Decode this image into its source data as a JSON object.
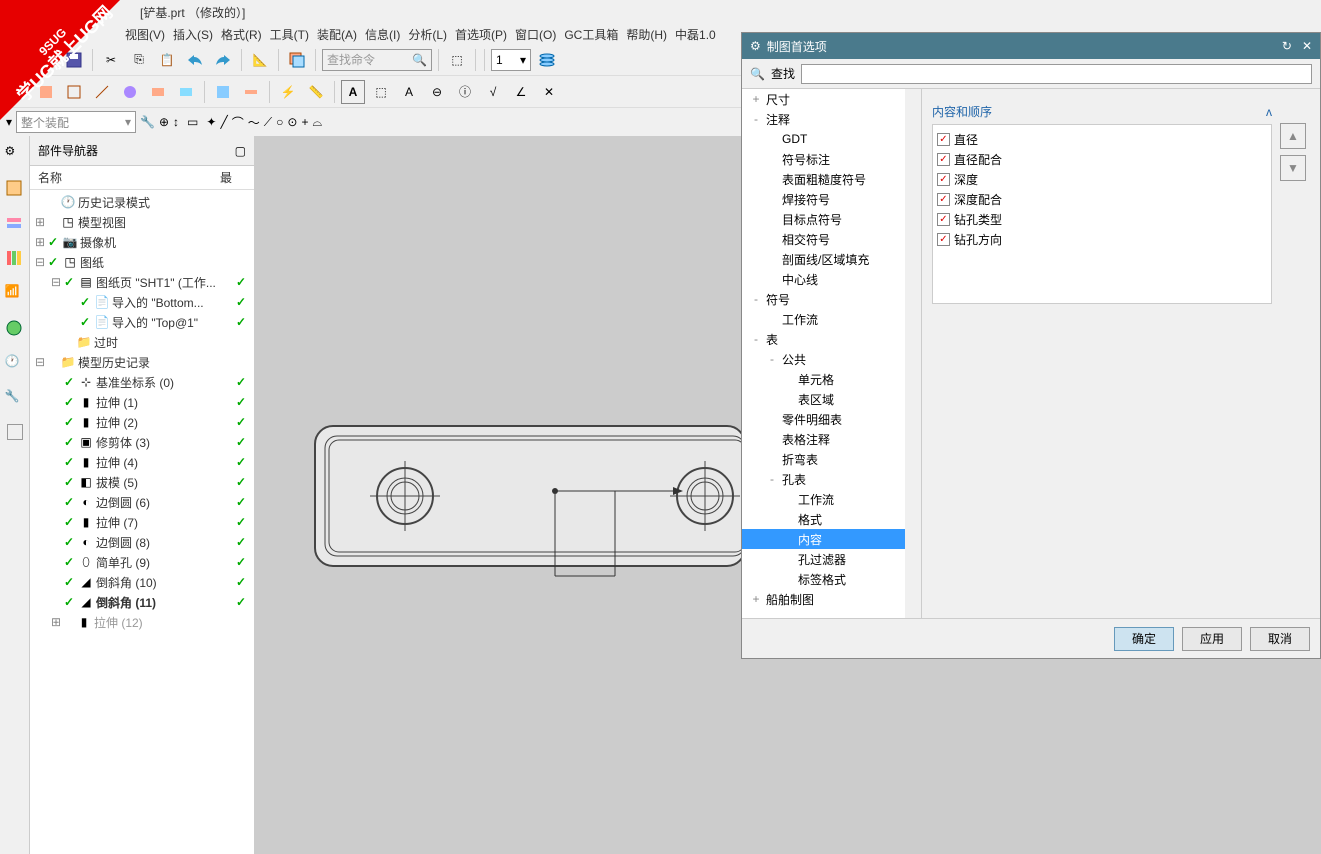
{
  "title": "[铲基.prt （修改的）]",
  "watermark": {
    "line1": "9SUG",
    "line2": "学UG就上UG网"
  },
  "menus": [
    "视图(V)",
    "插入(S)",
    "格式(R)",
    "工具(T)",
    "装配(A)",
    "信息(I)",
    "分析(L)",
    "首选项(P)",
    "窗口(O)",
    "GC工具箱",
    "帮助(H)",
    "中磊1.0"
  ],
  "toolbar": {
    "search_placeholder": "查找命令",
    "page_num": "1"
  },
  "assembly_combo": "整个装配",
  "nav": {
    "title": "部件导航器",
    "col1": "名称",
    "col2": "最",
    "items": [
      {
        "indent": 0,
        "exp": "",
        "chk": false,
        "icon": "clock",
        "label": "历史记录模式",
        "tick": false
      },
      {
        "indent": 0,
        "exp": "+",
        "chk": false,
        "icon": "cube-g",
        "label": "模型视图",
        "tick": false
      },
      {
        "indent": 0,
        "exp": "+",
        "chk": true,
        "icon": "camera",
        "label": "摄像机",
        "tick": false
      },
      {
        "indent": 0,
        "exp": "-",
        "chk": true,
        "icon": "cube-b",
        "label": "图纸",
        "tick": false
      },
      {
        "indent": 1,
        "exp": "-",
        "chk": true,
        "icon": "sheet",
        "label": "图纸页 \"SHT1\" (工作...",
        "tick": true
      },
      {
        "indent": 2,
        "exp": "",
        "chk": true,
        "icon": "page",
        "label": "导入的 \"Bottom...",
        "tick": true
      },
      {
        "indent": 2,
        "exp": "",
        "chk": true,
        "icon": "page",
        "label": "导入的 \"Top@1\"",
        "tick": true
      },
      {
        "indent": 1,
        "exp": "",
        "chk": false,
        "icon": "folder-q",
        "label": "过时",
        "tick": false
      },
      {
        "indent": 0,
        "exp": "-",
        "chk": false,
        "icon": "folder",
        "label": "模型历史记录",
        "tick": false
      },
      {
        "indent": 1,
        "exp": "",
        "chk": true,
        "icon": "csys",
        "label": "基准坐标系 (0)",
        "tick": true
      },
      {
        "indent": 1,
        "exp": "",
        "chk": true,
        "icon": "extrude",
        "label": "拉伸 (1)",
        "tick": true
      },
      {
        "indent": 1,
        "exp": "",
        "chk": true,
        "icon": "extrude",
        "label": "拉伸 (2)",
        "tick": true
      },
      {
        "indent": 1,
        "exp": "",
        "chk": true,
        "icon": "trim",
        "label": "修剪体 (3)",
        "tick": true
      },
      {
        "indent": 1,
        "exp": "",
        "chk": true,
        "icon": "extrude",
        "label": "拉伸 (4)",
        "tick": true
      },
      {
        "indent": 1,
        "exp": "",
        "chk": true,
        "icon": "draft",
        "label": "拔模 (5)",
        "tick": true
      },
      {
        "indent": 1,
        "exp": "",
        "chk": true,
        "icon": "blend",
        "label": "边倒圆 (6)",
        "tick": true
      },
      {
        "indent": 1,
        "exp": "",
        "chk": true,
        "icon": "extrude",
        "label": "拉伸 (7)",
        "tick": true
      },
      {
        "indent": 1,
        "exp": "",
        "chk": true,
        "icon": "blend",
        "label": "边倒圆 (8)",
        "tick": true
      },
      {
        "indent": 1,
        "exp": "",
        "chk": true,
        "icon": "hole",
        "label": "简单孔 (9)",
        "tick": true
      },
      {
        "indent": 1,
        "exp": "",
        "chk": true,
        "icon": "chamfer",
        "label": "倒斜角 (10)",
        "tick": true
      },
      {
        "indent": 1,
        "exp": "",
        "chk": true,
        "icon": "chamfer",
        "label": "倒斜角 (11)",
        "tick": true,
        "bold": true
      },
      {
        "indent": 1,
        "exp": "+",
        "chk": false,
        "icon": "extrude-g",
        "label": "拉伸 (12)",
        "tick": false,
        "gray": true
      }
    ]
  },
  "dialog": {
    "title": "制图首选项",
    "search_label": "查找",
    "tree": [
      {
        "indent": 0,
        "exp": "+",
        "label": "尺寸"
      },
      {
        "indent": 0,
        "exp": "-",
        "label": "注释"
      },
      {
        "indent": 1,
        "exp": "",
        "label": "GDT"
      },
      {
        "indent": 1,
        "exp": "",
        "label": "符号标注"
      },
      {
        "indent": 1,
        "exp": "",
        "label": "表面粗糙度符号"
      },
      {
        "indent": 1,
        "exp": "",
        "label": "焊接符号"
      },
      {
        "indent": 1,
        "exp": "",
        "label": "目标点符号"
      },
      {
        "indent": 1,
        "exp": "",
        "label": "相交符号"
      },
      {
        "indent": 1,
        "exp": "",
        "label": "剖面线/区域填充"
      },
      {
        "indent": 1,
        "exp": "",
        "label": "中心线"
      },
      {
        "indent": 0,
        "exp": "-",
        "label": "符号"
      },
      {
        "indent": 1,
        "exp": "",
        "label": "工作流"
      },
      {
        "indent": 0,
        "exp": "-",
        "label": "表"
      },
      {
        "indent": 1,
        "exp": "-",
        "label": "公共"
      },
      {
        "indent": 2,
        "exp": "",
        "label": "单元格"
      },
      {
        "indent": 2,
        "exp": "",
        "label": "表区域"
      },
      {
        "indent": 1,
        "exp": "",
        "label": "零件明细表"
      },
      {
        "indent": 1,
        "exp": "",
        "label": "表格注释"
      },
      {
        "indent": 1,
        "exp": "",
        "label": "折弯表"
      },
      {
        "indent": 1,
        "exp": "-",
        "label": "孔表"
      },
      {
        "indent": 2,
        "exp": "",
        "label": "工作流"
      },
      {
        "indent": 2,
        "exp": "",
        "label": "格式"
      },
      {
        "indent": 2,
        "exp": "",
        "label": "内容",
        "selected": true
      },
      {
        "indent": 2,
        "exp": "",
        "label": "孔过滤器"
      },
      {
        "indent": 2,
        "exp": "",
        "label": "标签格式"
      },
      {
        "indent": 0,
        "exp": "+",
        "label": "船舶制图"
      }
    ],
    "content_header": "内容和顺序",
    "checklist": [
      "直径",
      "直径配合",
      "深度",
      "深度配合",
      "钻孔类型",
      "钻孔方向"
    ],
    "buttons": {
      "ok": "确定",
      "apply": "应用",
      "cancel": "取消"
    }
  }
}
